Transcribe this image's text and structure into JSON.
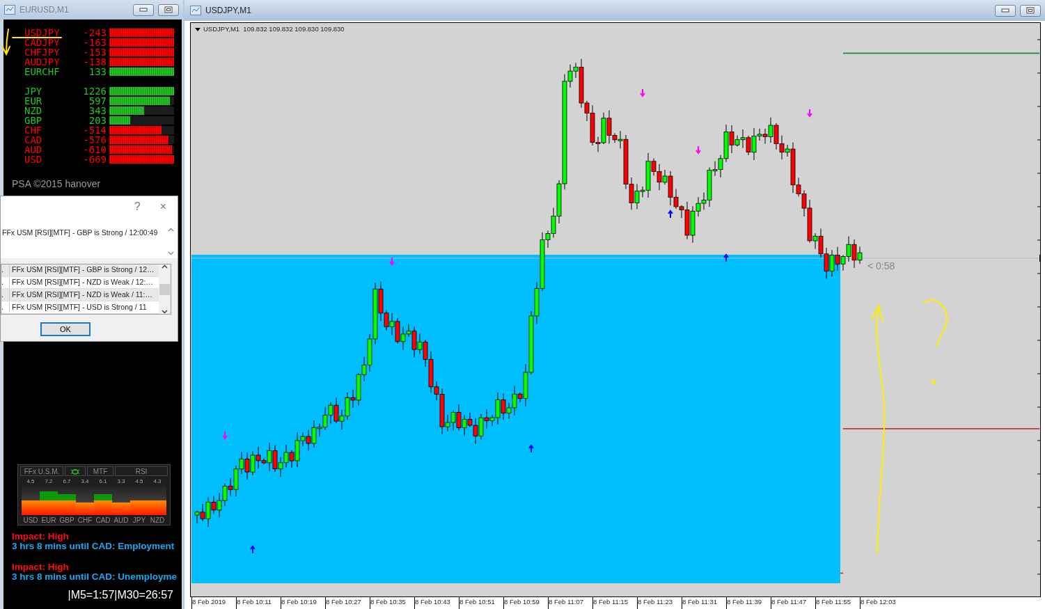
{
  "left_window": {
    "title": "EURUSD,M1",
    "pairs": [
      {
        "name": "USDJPY",
        "value": "-243",
        "color": "#ff0000",
        "level": 1
      },
      {
        "name": "CADJPY",
        "value": "-163",
        "color": "#ff0000",
        "level": 1
      },
      {
        "name": "CHFJPY",
        "value": "-153",
        "color": "#ff0000",
        "level": 1
      },
      {
        "name": "AUDJPY",
        "value": "-138",
        "color": "#ff0000",
        "level": 1
      },
      {
        "name": "EURCHF",
        "value": "133",
        "color": "#22c322",
        "level": 1
      }
    ],
    "currencies": [
      {
        "name": "JPY",
        "value": "1226",
        "color": "#22c322",
        "level": 1
      },
      {
        "name": "EUR",
        "value": "597",
        "color": "#22c322",
        "level": 0.94
      },
      {
        "name": "NZD",
        "value": "343",
        "color": "#22c322",
        "level": 0.54
      },
      {
        "name": "GBP",
        "value": "203",
        "color": "#22c322",
        "level": 0.32
      },
      {
        "name": "CHF",
        "value": "-514",
        "color": "#ff0000",
        "level": 0.81
      },
      {
        "name": "CAD",
        "value": "-576",
        "color": "#ff0000",
        "level": 0.91
      },
      {
        "name": "AUD",
        "value": "-610",
        "color": "#ff0000",
        "level": 0.97
      },
      {
        "name": "USD",
        "value": "-669",
        "color": "#ff0000",
        "level": 1
      }
    ],
    "footer": "PSA ©2015 hanover",
    "meter": {
      "title": "FFx U.S.M.",
      "tabs": [
        "MTF",
        "RSI"
      ],
      "bars": [
        {
          "value": "4.5",
          "label": "USD"
        },
        {
          "value": "7.2",
          "label": "EUR"
        },
        {
          "value": "6.7",
          "label": "GBP"
        },
        {
          "value": "3.4",
          "label": "CHF"
        },
        {
          "value": "6.1",
          "label": "CAD"
        },
        {
          "value": "3.3",
          "label": "AUD"
        },
        {
          "value": "4.5",
          "label": "JPY"
        },
        {
          "value": "4.3",
          "label": "NZD"
        }
      ]
    },
    "news": [
      {
        "impact": "Impact: High",
        "text": "3 hrs 8 mins until CAD: Employment"
      },
      {
        "impact": "Impact: High",
        "text": "3 hrs 8 mins until CAD: Unemployme"
      }
    ],
    "timer": "|M5=1:57|M30=26:57"
  },
  "dialog": {
    "help": "?",
    "close": "×",
    "message": "FFx USM [RSI][MTF] - GBP is Strong / 12:00:49",
    "rows": [
      {
        "column_1": ".",
        "text": "FFx USM [RSI][MTF] - GBP is Strong / 12…",
        "highlighted": true
      },
      {
        "column_1": ".",
        "text": "FFx USM [RSI][MTF] - NZD is Weak / 12:…",
        "highlighted": false
      },
      {
        "column_1": ".",
        "text": "FFx USM [RSI][MTF] - NZD is Weak / 11:…",
        "highlighted": true
      },
      {
        "column_1": ".",
        "text": "FFx USM [RSI][MTF] - USD is Strong / 11",
        "highlighted": false
      }
    ],
    "ok": "OK"
  },
  "chart_window": {
    "title": "USDJPY,M1",
    "header": "USDJPY,M1  109.832 109.832 109.830 109.830",
    "countdown": "< 0:58",
    "x_labels": [
      "8 Feb 2019",
      "8 Feb 10:11",
      "8 Feb 10:19",
      "8 Feb 10:27",
      "8 Feb 10:35",
      "8 Feb 10:43",
      "8 Feb 10:51",
      "8 Feb 10:59",
      "8 Feb 11:07",
      "8 Feb 11:15",
      "8 Feb 11:23",
      "8 Feb 11:31",
      "8 Feb 11:39",
      "8 Feb 11:47",
      "8 Feb 11:55",
      "8 Feb 12:03"
    ]
  }
}
